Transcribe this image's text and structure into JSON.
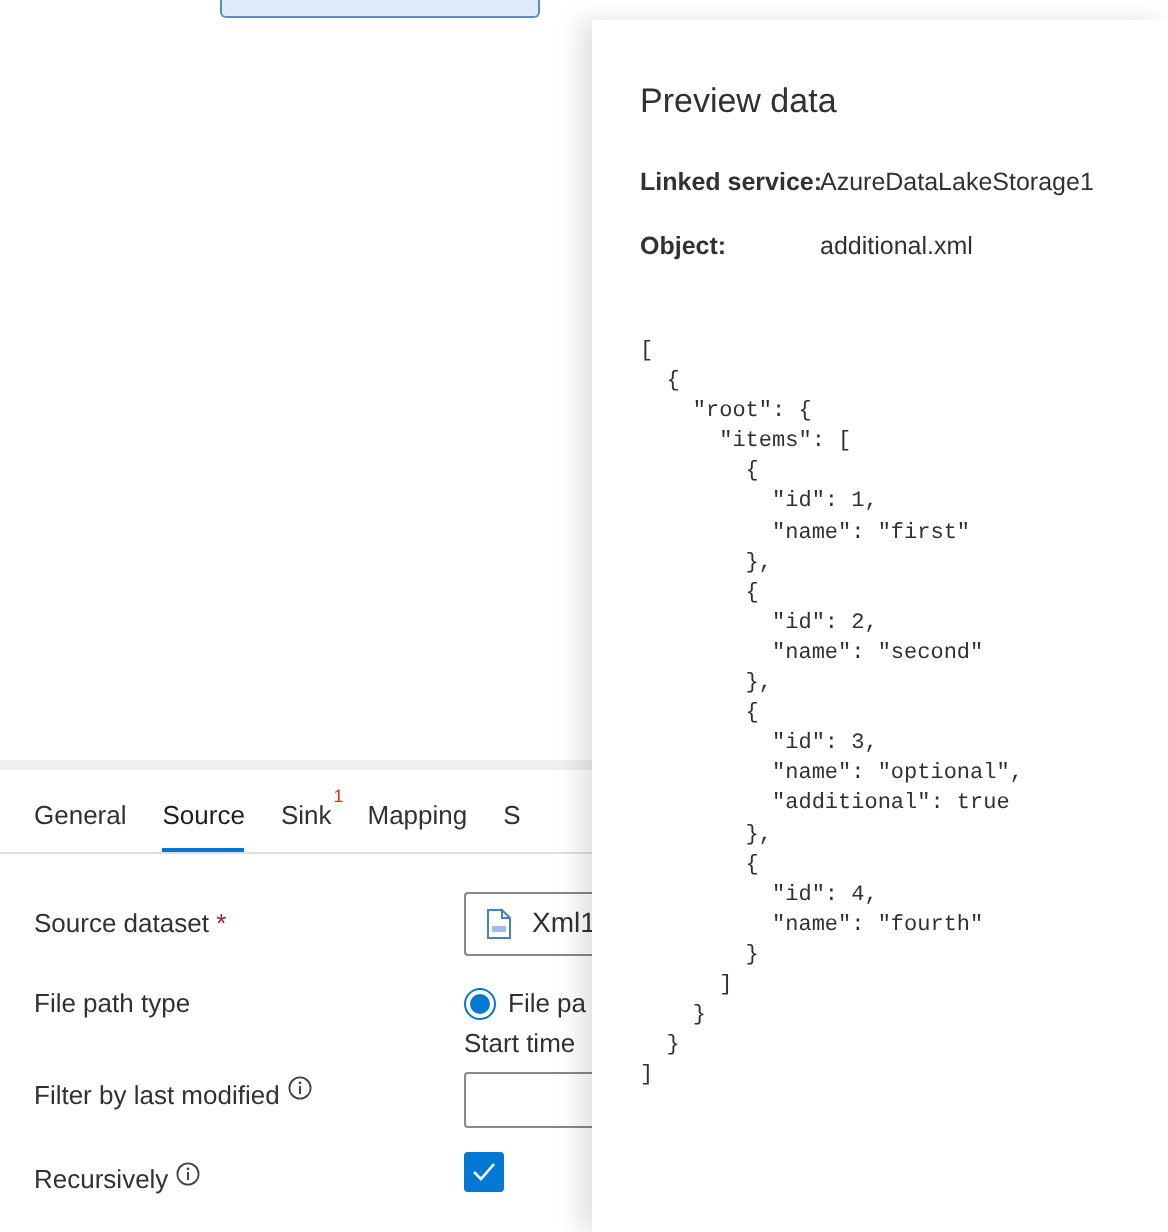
{
  "tabs": [
    {
      "label": "General",
      "selected": false
    },
    {
      "label": "Source",
      "selected": true
    },
    {
      "label": "Sink",
      "selected": false,
      "badge": "1"
    },
    {
      "label": "Mapping",
      "selected": false
    },
    {
      "label": "S",
      "selected": false
    }
  ],
  "form": {
    "source_dataset": {
      "label": "Source dataset",
      "required_mark": "*",
      "value": "Xml1"
    },
    "file_path_type": {
      "label": "File path type",
      "option": "File pa",
      "selected": true
    },
    "filter_by_last_modified": {
      "label": "Filter by last modified",
      "start_time_label": "Start time"
    },
    "recursively": {
      "label": "Recursively",
      "checked": true
    }
  },
  "preview": {
    "title": "Preview data",
    "linked_service_label": "Linked service:",
    "linked_service": "AzureDataLakeStorage1",
    "object_label": "Object:",
    "object": "additional.xml",
    "code_lines": [
      "[",
      "  {",
      "    \"root\": {",
      "      \"items\": [",
      "        {",
      "          \"id\": 1,",
      "          \"name\": \"first\"",
      "        },",
      "        {",
      "          \"id\": 2,",
      "          \"name\": \"second\"",
      "        },",
      "        {",
      "          \"id\": 3,",
      "          \"name\": \"optional\",",
      "          \"additional\": true",
      "        },",
      "        {",
      "          \"id\": 4,",
      "          \"name\": \"fourth\"",
      "        }",
      "      ]",
      "    }",
      "  }",
      "]"
    ]
  }
}
